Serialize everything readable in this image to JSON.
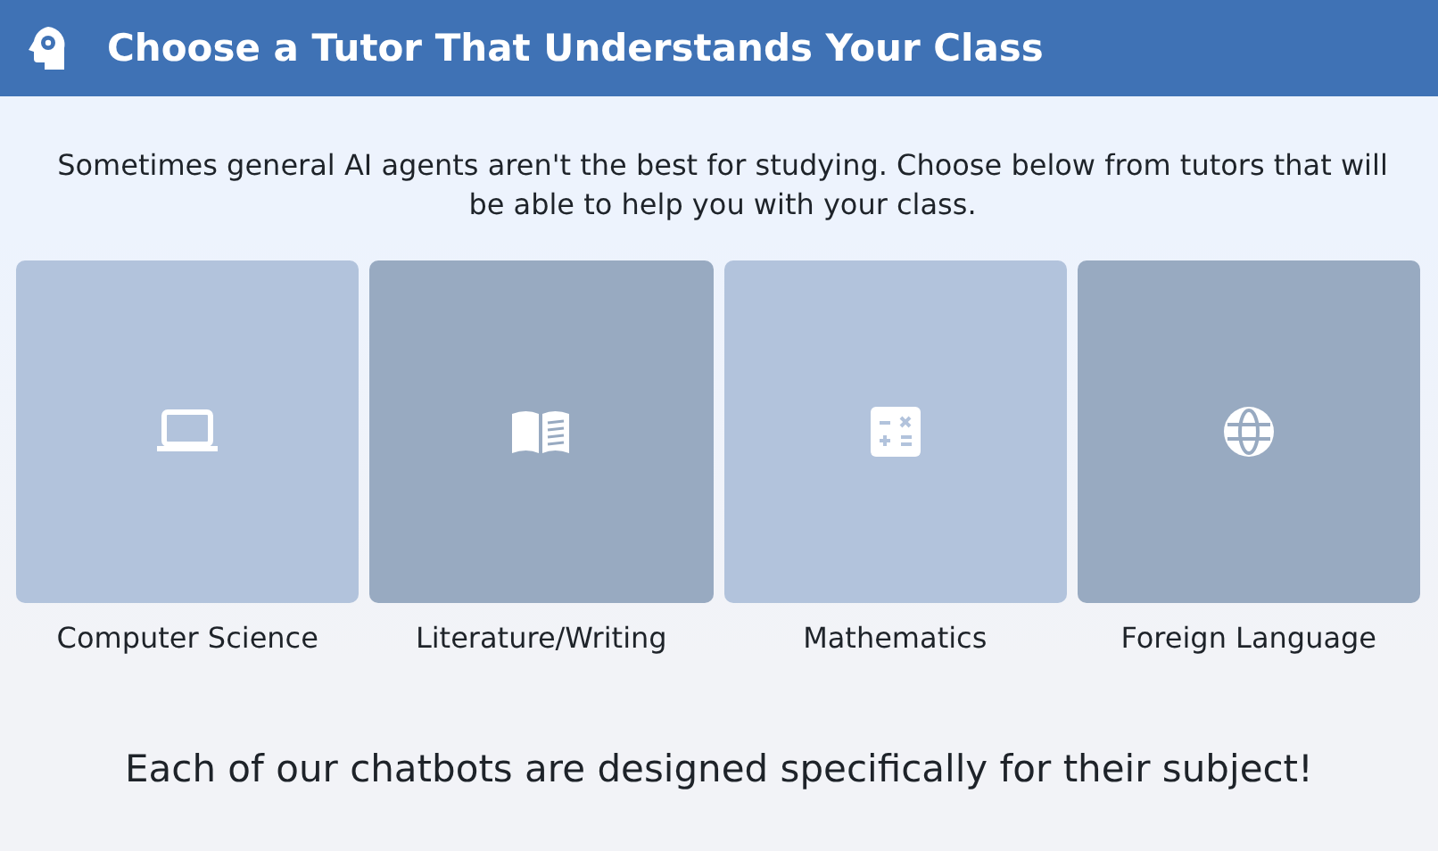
{
  "header": {
    "title": "Choose a Tutor That Understands Your Class"
  },
  "intro": "Sometimes general AI agents aren't the best for studying. Choose below from tutors that will be able to help you with your class.",
  "tutors": [
    {
      "label": "Computer Science",
      "color": "#b2c3dc"
    },
    {
      "label": "Literature/Writing",
      "color": "#98aac1"
    },
    {
      "label": "Mathematics",
      "color": "#b2c3dc"
    },
    {
      "label": "Foreign Language",
      "color": "#98aac1"
    }
  ],
  "footer": "Each of our chatbots are designed specifically for their subject!"
}
